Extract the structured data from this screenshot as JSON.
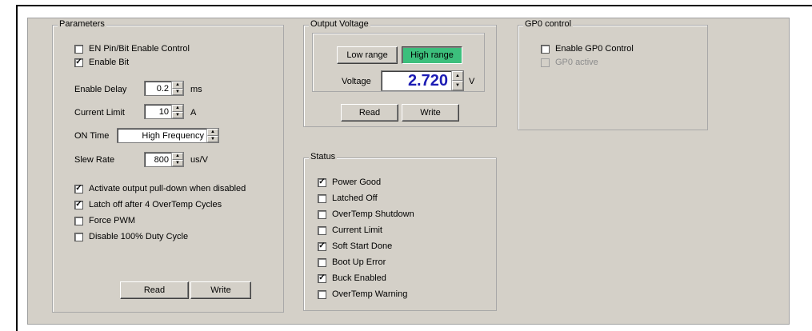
{
  "parameters": {
    "title": "Parameters",
    "en_pin": {
      "label": "EN Pin/Bit Enable Control",
      "checked": false
    },
    "enable_bit": {
      "label": "Enable Bit",
      "checked": true
    },
    "enable_delay": {
      "label": "Enable Delay",
      "value": "0.2",
      "unit": "ms"
    },
    "current_limit": {
      "label": "Current Limit",
      "value": "10",
      "unit": "A"
    },
    "on_time": {
      "label": "ON Time",
      "value": "High Frequency"
    },
    "slew_rate": {
      "label": "Slew Rate",
      "value": "800",
      "unit": "us/V"
    },
    "options": [
      {
        "label": "Activate output pull-down when disabled",
        "checked": true
      },
      {
        "label": "Latch off after 4 OverTemp Cycles",
        "checked": true
      },
      {
        "label": "Force PWM",
        "checked": false
      },
      {
        "label": "Disable 100% Duty Cycle",
        "checked": false
      }
    ],
    "read_label": "Read",
    "write_label": "Write"
  },
  "output_voltage": {
    "title": "Output Voltage",
    "low_range_label": "Low range",
    "high_range_label": "High range",
    "voltage_label": "Voltage",
    "voltage_value": "2.720",
    "unit": "V",
    "read_label": "Read",
    "write_label": "Write"
  },
  "status": {
    "title": "Status",
    "items": [
      {
        "label": "Power Good",
        "checked": true
      },
      {
        "label": "Latched Off",
        "checked": false
      },
      {
        "label": "OverTemp Shutdown",
        "checked": false
      },
      {
        "label": "Current Limit",
        "checked": false
      },
      {
        "label": "Soft Start Done",
        "checked": true
      },
      {
        "label": "Boot Up Error",
        "checked": false
      },
      {
        "label": "Buck Enabled",
        "checked": true
      },
      {
        "label": "OverTemp Warning",
        "checked": false
      }
    ]
  },
  "gp0": {
    "title": "GP0 control",
    "enable": {
      "label": "Enable GP0 Control",
      "checked": false
    },
    "active": {
      "label": "GP0 active",
      "checked": false
    }
  },
  "colors": {
    "panel": "#d4d0c8",
    "active_button": "#3cbf7c",
    "voltage_text": "#1c1cb4"
  }
}
